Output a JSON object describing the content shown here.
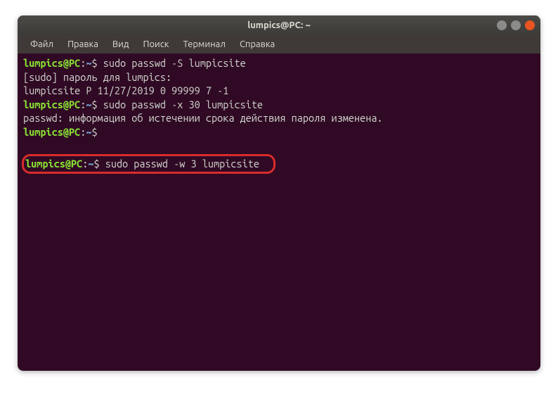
{
  "titlebar": {
    "title": "lumpics@PC: ~"
  },
  "menubar": {
    "items": [
      "Файл",
      "Правка",
      "Вид",
      "Поиск",
      "Терминал",
      "Справка"
    ]
  },
  "prompt": {
    "user_host": "lumpics@PC",
    "sep": ":",
    "path": "~",
    "dollar": "$"
  },
  "lines": {
    "cmd1": " sudo passwd -S lumpicsite",
    "out1": "[sudo] пароль для lumpics:",
    "out2": "lumpicsite P 11/27/2019 0 99999 7 -1",
    "cmd2": " sudo passwd -x 30 lumpicsite",
    "out3": "passwd: информация об истечении срока действия пароля изменена.",
    "cmd3_blurred": "                                 ",
    "blur_line": "                                               ",
    "cmd4": " sudo passwd -w 3 lumpicsite"
  }
}
